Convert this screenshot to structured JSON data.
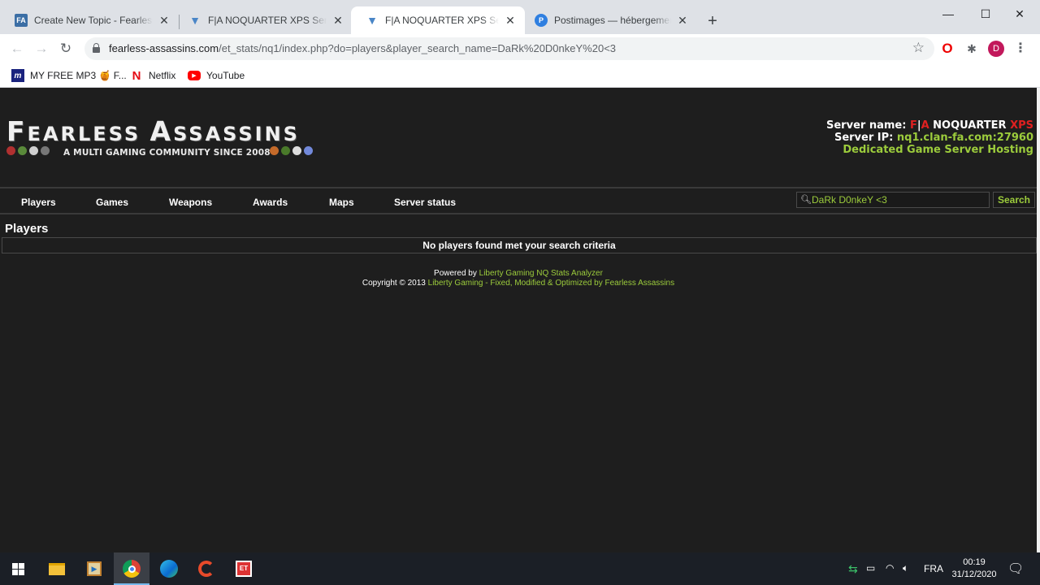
{
  "browser": {
    "tabs": [
      {
        "title": "Create New Topic - Fearless Assassins",
        "favicon": "fa-forum-icon",
        "active": false
      },
      {
        "title": "F|A NOQUARTER XPS Server stats",
        "favicon": "stats-v-icon",
        "active": false
      },
      {
        "title": "F|A NOQUARTER XPS Server stats",
        "favicon": "stats-v-icon",
        "active": true
      },
      {
        "title": "Postimages — hébergement gratuit d'images",
        "favicon": "postimages-icon",
        "active": false
      }
    ],
    "new_tab_label": "+",
    "url_host": "fearless-assassins.com",
    "url_path": "/et_stats/nq1/index.php?do=players&player_search_name=DaRk%20D0nkeY%20<3",
    "profile_initial": "D",
    "bookmarks": [
      {
        "label": "MY FREE MP3 🍯 F...",
        "icon": "mp3-m-icon"
      },
      {
        "label": "Netflix",
        "icon": "netflix-icon"
      },
      {
        "label": "YouTube",
        "icon": "youtube-icon"
      }
    ]
  },
  "site": {
    "logo_first": "F",
    "logo_rest1": "EARLESS ",
    "logo_second": "A",
    "logo_rest2": "SSASSINS",
    "tagline": "A MULTI GAMING COMMUNITY SINCE 2008",
    "server_name_label": "Server name: ",
    "server_name_f": "F",
    "server_name_sep": "|",
    "server_name_a": "A",
    "server_name_mid": " NOQUARTER ",
    "server_name_xps": "XPS",
    "server_ip_label": "Server IP: ",
    "server_ip": "nq1.clan-fa.com:27960",
    "hosting": "Dedicated Game Server Hosting",
    "menu": [
      "Players",
      "Games",
      "Weapons",
      "Awards",
      "Maps",
      "Server status"
    ],
    "search_value": "DaRk D0nkeY <3",
    "search_button": "Search",
    "section_title": "Players",
    "result_message": "No players found met your search criteria",
    "footer_powered_label": "Powered by ",
    "footer_powered_link": "Liberty Gaming NQ Stats Analyzer",
    "footer_copyright_label": "Copyright © 2013 ",
    "footer_copyright_link": "Liberty Gaming - Fixed, Modified & Optimized by Fearless Assassins",
    "colors": {
      "accent_green": "#9ccc3c",
      "accent_red": "#e02020",
      "background": "#1e1e1e"
    }
  },
  "taskbar": {
    "language": "FRA",
    "time": "00:19",
    "date": "31/12/2020"
  }
}
